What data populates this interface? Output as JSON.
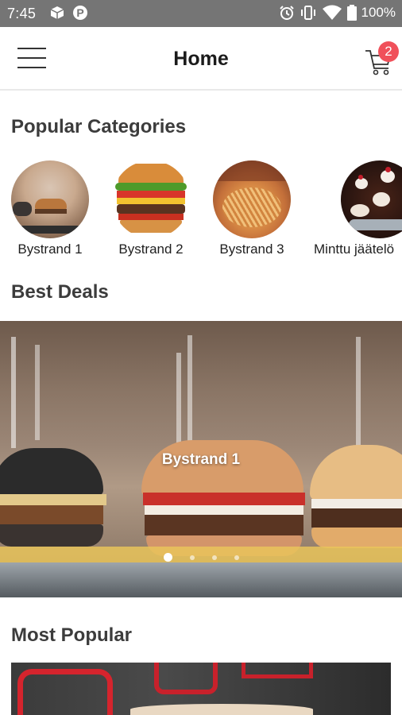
{
  "status_bar": {
    "time": "7:45",
    "battery": "100%",
    "left_icons": [
      "box-icon",
      "p-icon"
    ],
    "right_icons": [
      "alarm-icon",
      "vibrate-icon",
      "wifi-icon",
      "battery-icon"
    ]
  },
  "header": {
    "title": "Home",
    "cart_count": "2",
    "accent": "#f0505a"
  },
  "popular_categories": {
    "title": "Popular Categories",
    "items": [
      {
        "label": "Bystrand 1"
      },
      {
        "label": "Bystrand 2"
      },
      {
        "label": "Bystrand 3"
      },
      {
        "label": "Minttu jäätelö"
      }
    ]
  },
  "best_deals": {
    "title": "Best Deals",
    "slides": [
      {
        "caption": "Bystrand 1"
      }
    ],
    "dot_count": 4,
    "active_dot": 1
  },
  "most_popular": {
    "title": "Most Popular"
  }
}
